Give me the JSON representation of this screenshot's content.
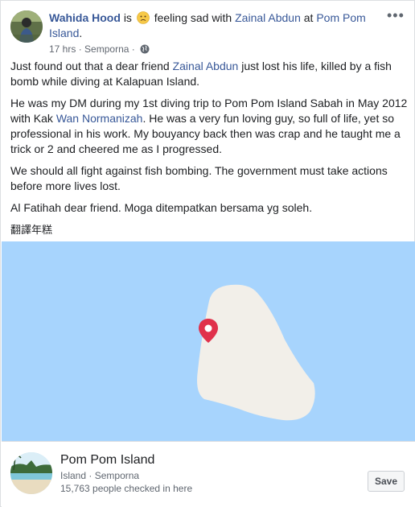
{
  "post": {
    "author": "Wahida Hood",
    "is_word": "is",
    "feeling_emoji": "sad-face",
    "feeling_text": "feeling sad with",
    "tagged_person": "Zainal Abdun",
    "at_word": "at",
    "location_name": "Pom Pom Island",
    "location_suffix": ".",
    "time": "17 hrs",
    "separator": "·",
    "place": "Semporna",
    "privacy_icon": "globe-icon",
    "more_icon": "more-options-icon",
    "paragraphs": {
      "p1_before": "Just found out that a dear friend ",
      "p1_link": "Zainal Abdun",
      "p1_after": " just lost his life, killed by a fish bomb while diving at Kalapuan Island.",
      "p2_before": "He was my DM during my 1st diving trip to Pom Pom Island Sabah in May 2012 with Kak ",
      "p2_link": "Wan Normanizah",
      "p2_after": ". He was a very fun loving guy, so full of life, yet so professional in his work. My bouyancy back then was crap and he taught me a trick or 2 and cheered me as I progressed.",
      "p3": "We should all fight against fish bombing. The government must take actions before more lives lost.",
      "p4": "Al Fatihah dear friend. Moga ditempatkan bersama yg soleh."
    },
    "translate_label": "翻譯年糕"
  },
  "map": {
    "water_color": "#a7d4fd",
    "land_color": "#f2efe9",
    "pin_color": "#e0314b",
    "pin_icon": "map-pin-icon"
  },
  "place_card": {
    "title": "Pom Pom Island",
    "category": "Island",
    "separator": "·",
    "city": "Semporna",
    "checkins": "15,763 people checked in here",
    "save_label": "Save"
  }
}
